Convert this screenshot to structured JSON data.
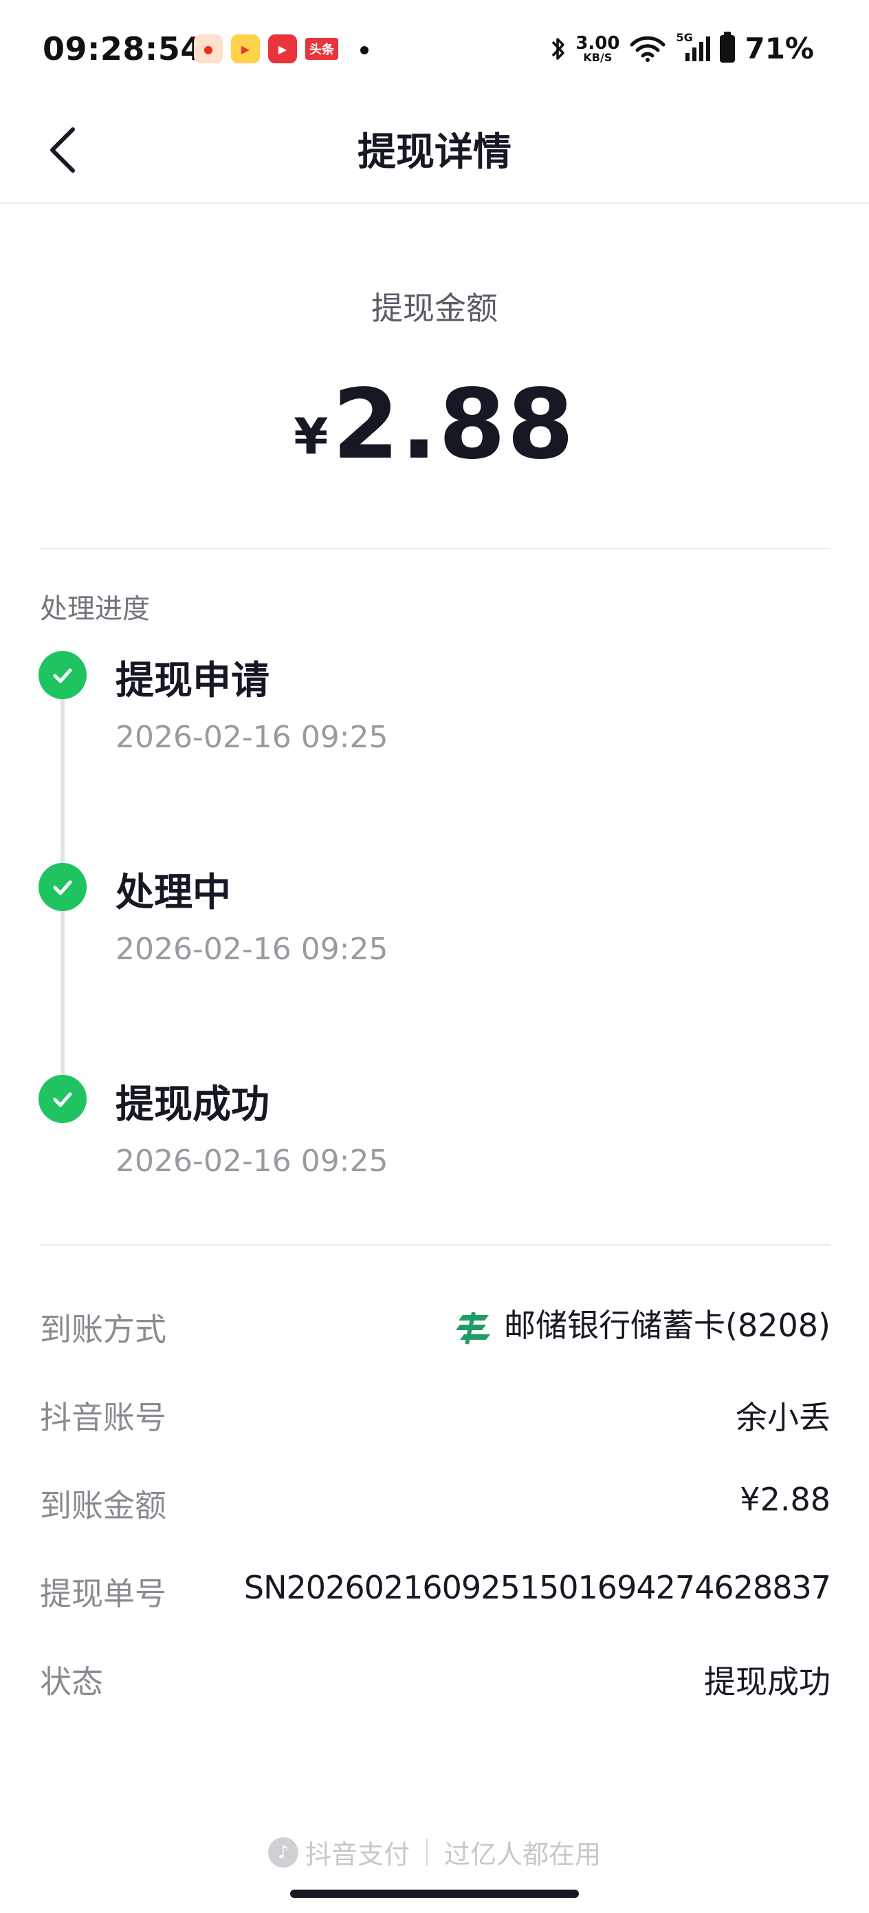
{
  "status_bar": {
    "time": "09:28:54",
    "app_icons": [
      "app-red-icon",
      "app-video-icon",
      "app-play-icon",
      "头条"
    ],
    "net_speed": "3.00",
    "net_speed_unit": "KB/S",
    "network": "5G",
    "battery": "71%"
  },
  "header": {
    "title": "提现详情"
  },
  "amount": {
    "label": "提现金额",
    "currency": "¥",
    "value": "2.88"
  },
  "progress": {
    "title": "处理进度",
    "steps": [
      {
        "title": "提现申请",
        "time": "2026-02-16 09:25"
      },
      {
        "title": "处理中",
        "time": "2026-02-16 09:25"
      },
      {
        "title": "提现成功",
        "time": "2026-02-16 09:25"
      }
    ]
  },
  "details": [
    {
      "label": "到账方式",
      "value": "邮储银行储蓄卡(8208)"
    },
    {
      "label": "抖音账号",
      "value": "余小丢"
    },
    {
      "label": "到账金额",
      "value": "¥2.88"
    },
    {
      "label": "提现单号",
      "value": "SN20260216092515016942746288 37"
    },
    {
      "label": "状态",
      "value": "提现成功"
    }
  ],
  "footer": {
    "brand": "抖音支付",
    "slogan": "过亿人都在用"
  },
  "colors": {
    "success_green": "#1fc461",
    "bank_green": "#1f9e63",
    "text_primary": "#161823",
    "text_secondary": "#8a8b91"
  }
}
